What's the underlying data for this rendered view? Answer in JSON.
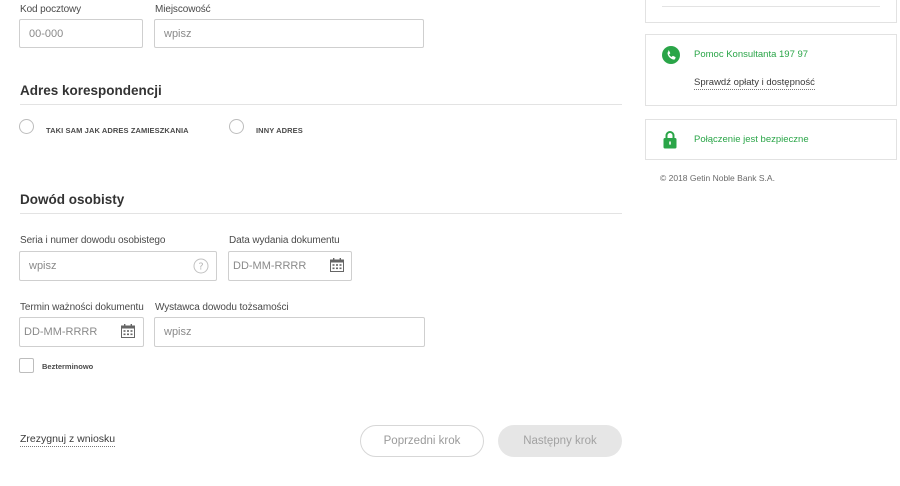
{
  "address": {
    "postal_code": {
      "label": "Kod pocztowy",
      "placeholder": "00-000"
    },
    "city": {
      "label": "Miejscowość",
      "placeholder": "wpisz"
    }
  },
  "correspondence": {
    "title": "Adres korespondencji",
    "options": [
      {
        "label": "TAKI SAM JAK ADRES ZAMIESZKANIA",
        "selected": false
      },
      {
        "label": "INNY ADRES",
        "selected": false
      }
    ]
  },
  "id_document": {
    "title": "Dowód osobisty",
    "series_number": {
      "label": "Seria i numer dowodu osobistego",
      "placeholder": "wpisz"
    },
    "issue_date": {
      "label": "Data wydania dokumentu",
      "placeholder": "DD-MM-RRRR"
    },
    "expiry_date": {
      "label": "Termin ważności dokumentu",
      "placeholder": "DD-MM-RRRR"
    },
    "issuer": {
      "label": "Wystawca dowodu tożsamości",
      "placeholder": "wpisz"
    },
    "indefinite": {
      "label": "Bezterminowo",
      "checked": false
    }
  },
  "actions": {
    "resign": "Zrezygnuj z wniosku",
    "prev": "Poprzedni krok",
    "next": "Następny krok"
  },
  "sidebar": {
    "help": {
      "title": "Pomoc Konsultanta 197 97",
      "link": "Sprawdź opłaty i dostępność"
    },
    "secure": {
      "text": "Połączenie jest bezpieczne"
    },
    "copyright": "© 2018 Getin Noble Bank S.A."
  },
  "colors": {
    "accent": "#2aa548",
    "button_disabled": "#e6e6e6",
    "border": "#cfcfcf"
  }
}
